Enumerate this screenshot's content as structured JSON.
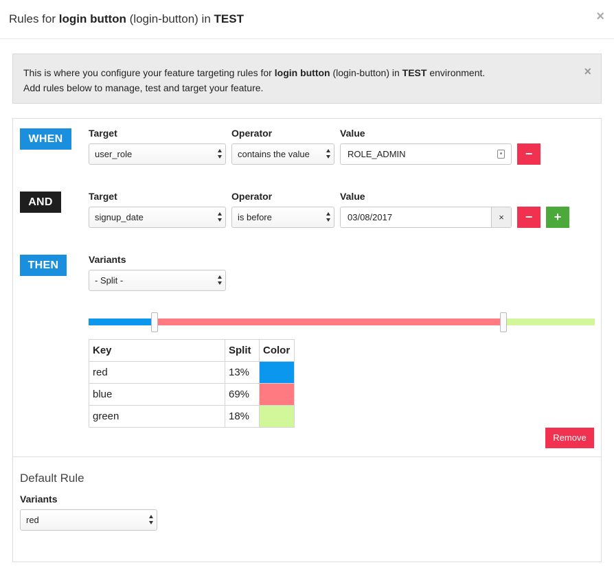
{
  "modal": {
    "title_prefix": "Rules for ",
    "feature_name": "login button",
    "feature_key": " (login-button) in ",
    "environment": "TEST",
    "close_glyph": "×"
  },
  "alert": {
    "line1_prefix": "This is where you configure your feature targeting rules for ",
    "feature_name": "login button",
    "line1_mid": " (login-button) in ",
    "environment": "TEST",
    "line1_suffix": " environment.",
    "line2": "Add rules below to manage, test and target your feature.",
    "close_glyph": "×"
  },
  "rule": {
    "when_tag": "WHEN",
    "and_tag": "AND",
    "then_tag": "THEN",
    "conditions": [
      {
        "target_label": "Target",
        "operator_label": "Operator",
        "value_label": "Value",
        "target": "user_role",
        "operator": "contains the value",
        "value": "ROLE_ADMIN",
        "remove_glyph": "−"
      },
      {
        "target_label": "Target",
        "operator_label": "Operator",
        "value_label": "Value",
        "target": "signup_date",
        "operator": "is before",
        "value": "03/08/2017",
        "clear_glyph": "×",
        "remove_glyph": "−",
        "add_glyph": "+"
      }
    ],
    "variants_label": "Variants",
    "variants_selected": "- Split -",
    "split_table": {
      "headers": [
        "Key",
        "Split",
        "Color"
      ],
      "rows": [
        {
          "key": "red",
          "split": "13%",
          "color": "#0b97ee"
        },
        {
          "key": "blue",
          "split": "69%",
          "color": "#ff7b81"
        },
        {
          "key": "green",
          "split": "18%",
          "color": "#d2f79b"
        }
      ]
    },
    "slider_levels": [
      0.13,
      0.69,
      0.18
    ],
    "remove_label": "Remove"
  },
  "default_rule": {
    "title": "Default Rule",
    "variants_label": "Variants",
    "selected": "red"
  },
  "colors": {
    "when_blue": "#1a8fde",
    "and_dark": "#1e1e1e",
    "danger_red": "#f0314f",
    "success_green": "#4aa93a"
  }
}
